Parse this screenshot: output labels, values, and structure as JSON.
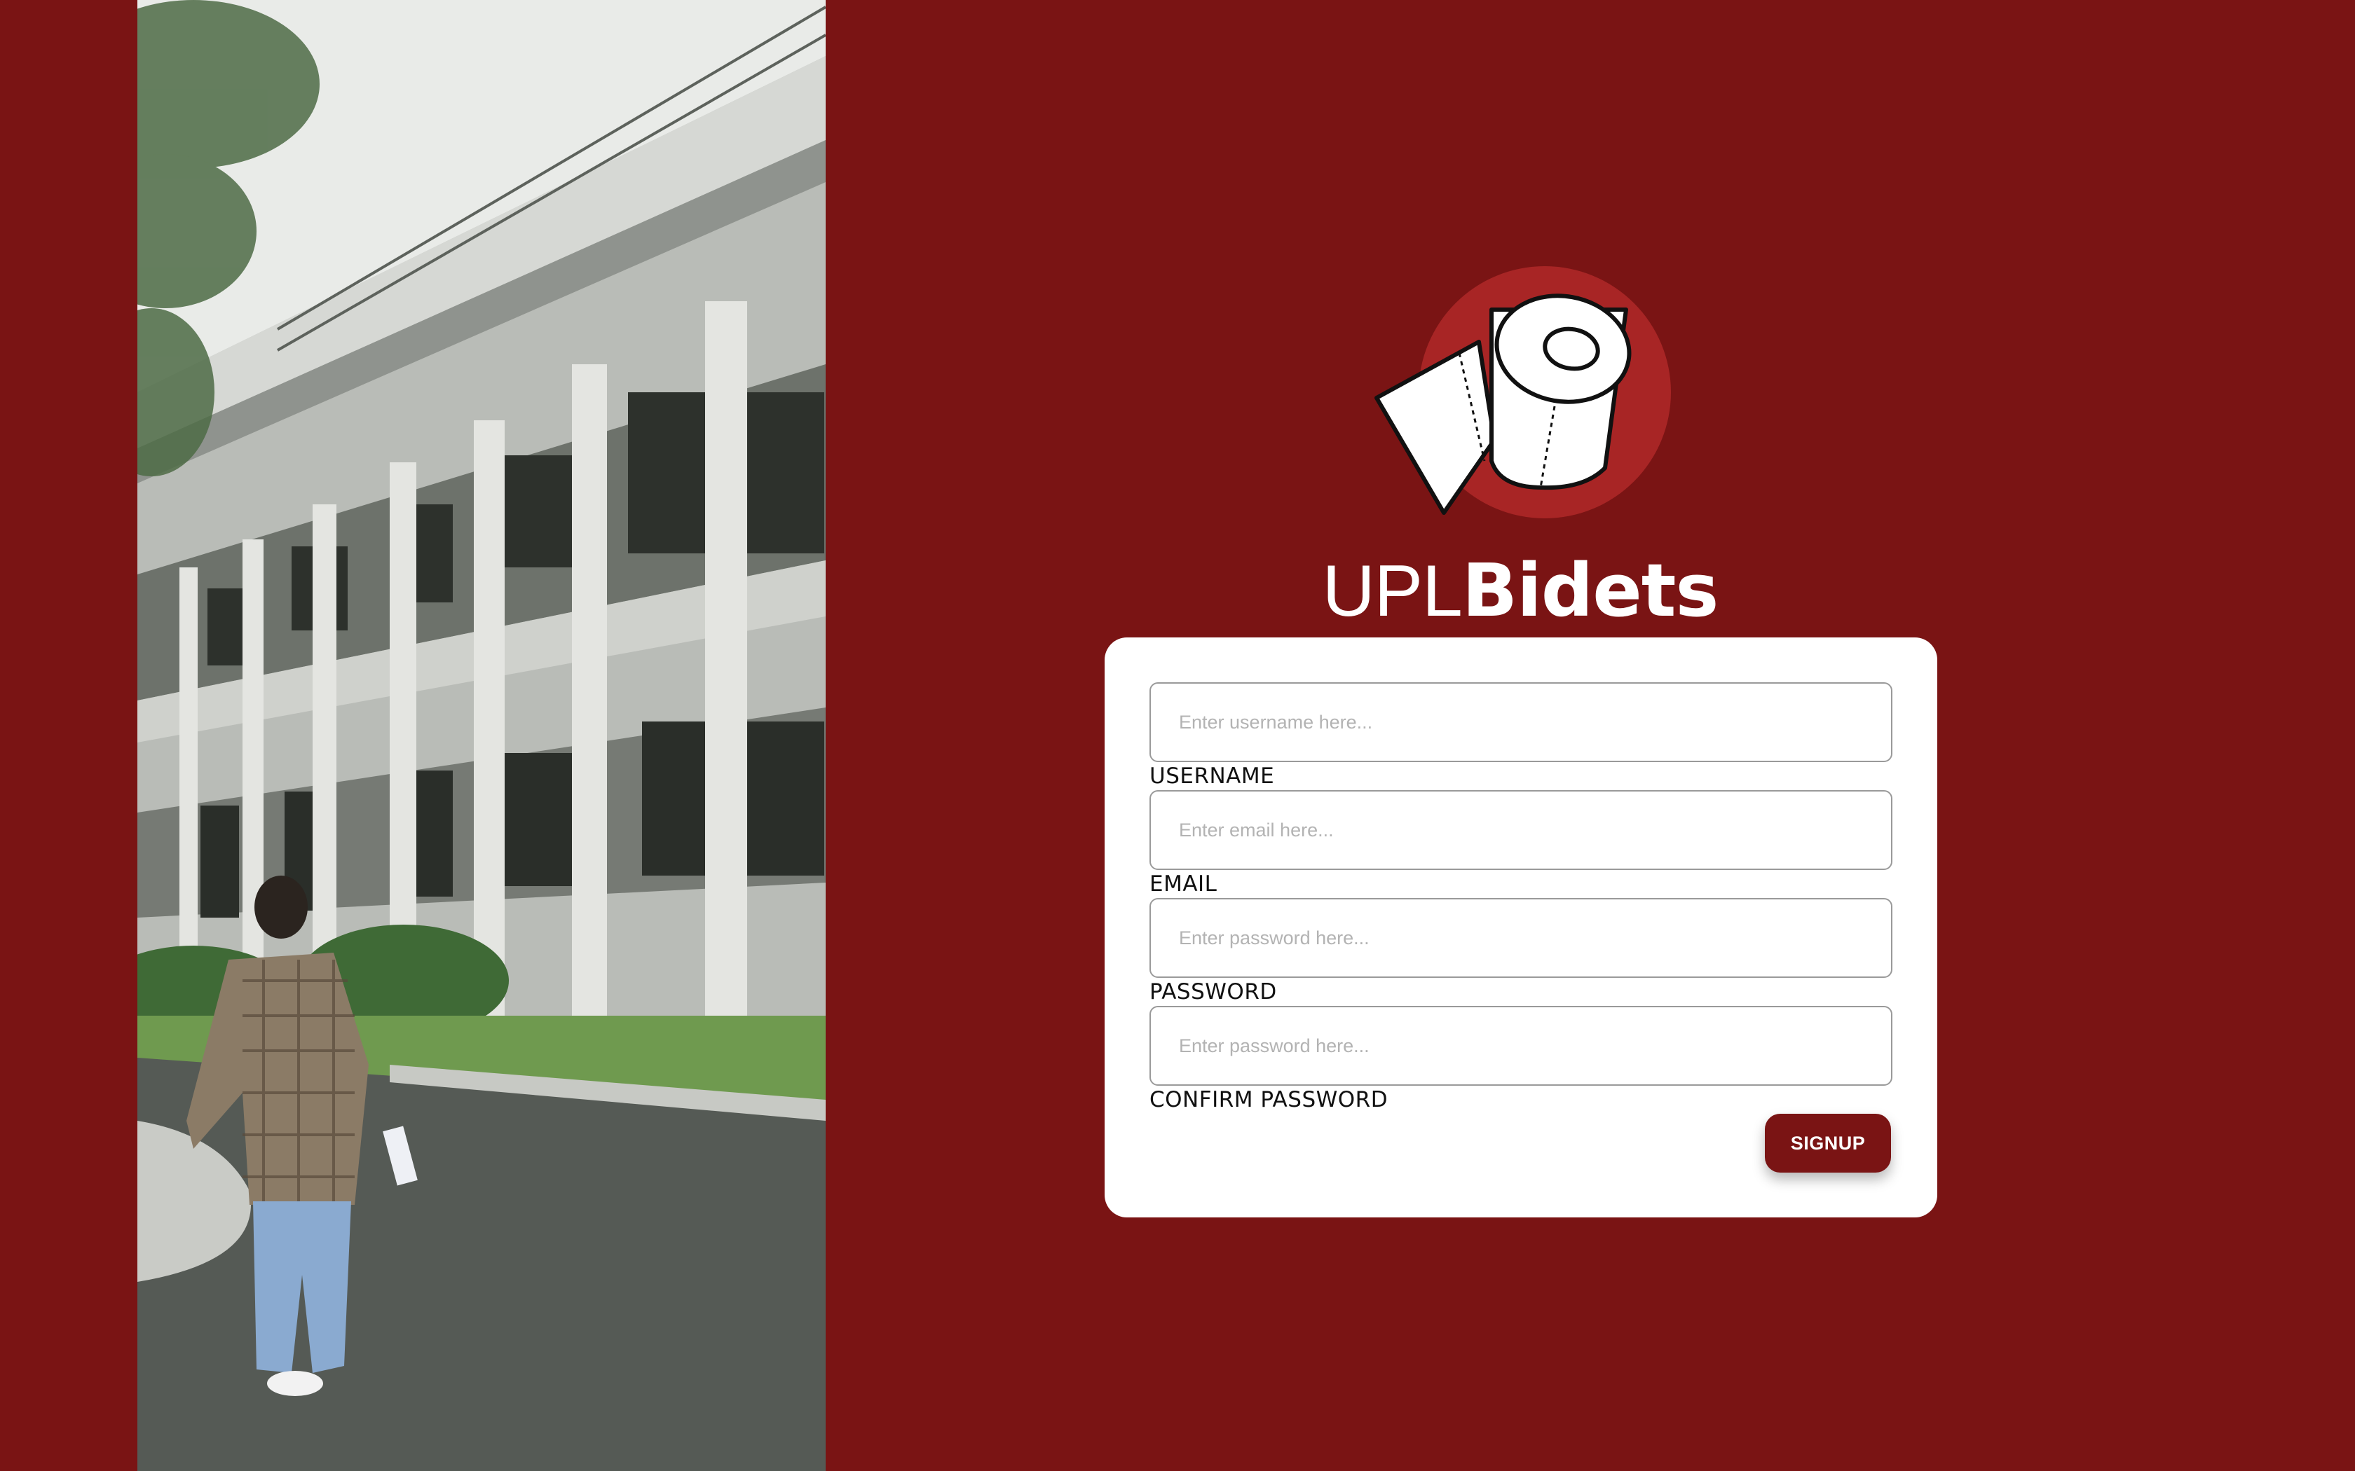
{
  "brand": {
    "prefix": "UPL",
    "name": "Bidets",
    "logo_icon": "toilet-paper-roll-icon",
    "accent_color": "#7a1414",
    "logo_circle_color": "#a82525"
  },
  "form": {
    "fields": [
      {
        "label": "USERNAME",
        "placeholder": "Enter username here...",
        "value": ""
      },
      {
        "label": "EMAIL",
        "placeholder": "Enter email here...",
        "value": ""
      },
      {
        "label": "PASSWORD",
        "placeholder": "Enter password here...",
        "value": ""
      },
      {
        "label": "CONFIRM PASSWORD",
        "placeholder": "Enter password here...",
        "value": ""
      }
    ],
    "submit_label": "SIGNUP"
  }
}
